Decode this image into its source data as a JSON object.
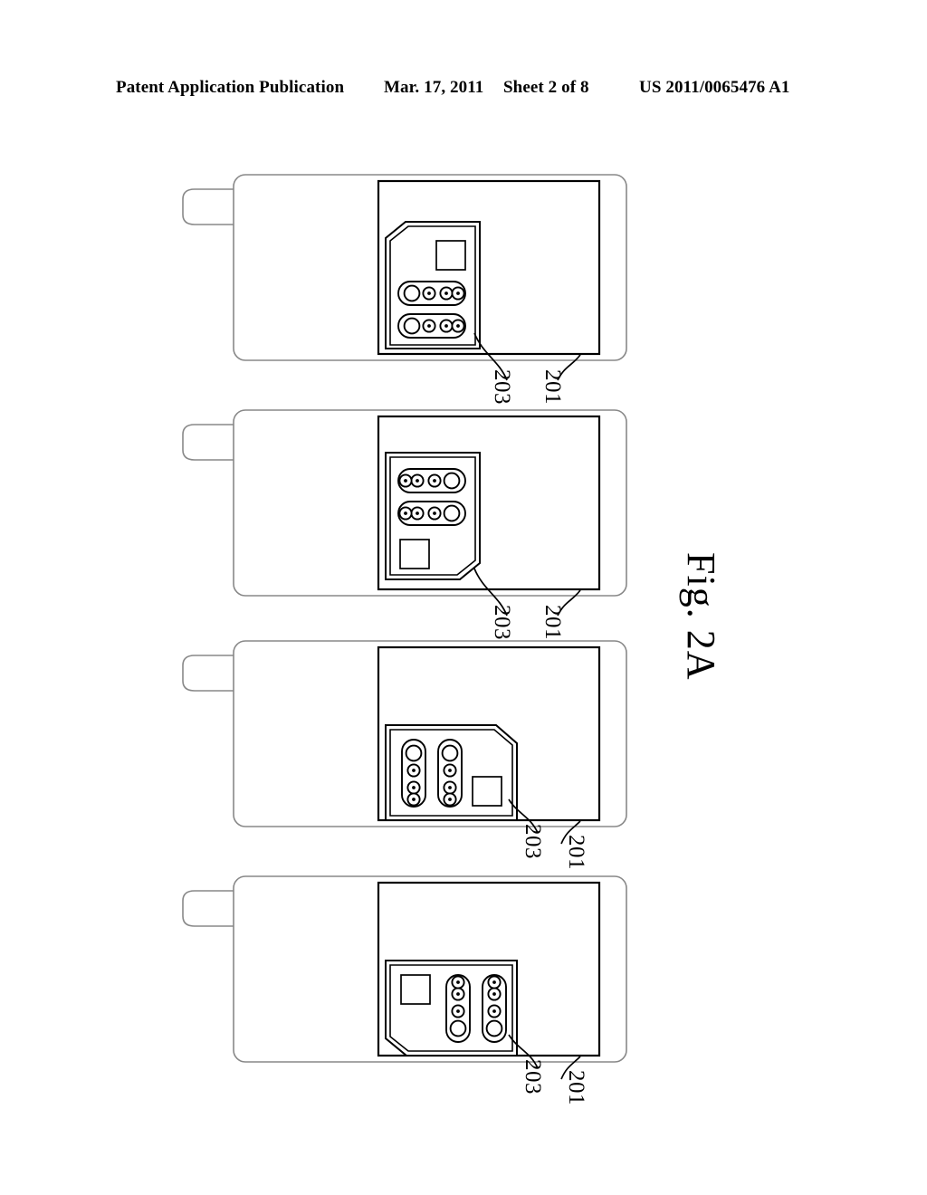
{
  "header": {
    "publication": "Patent Application Publication",
    "date": "Mar. 17, 2011",
    "sheet": "Sheet 2 of 8",
    "patent_number": "US 2011/0065476 A1"
  },
  "figure": {
    "caption": "Fig. 2A",
    "orientation": "rotated-90-clockwise",
    "panel_count": 4,
    "reference_numerals": {
      "device_body": "201",
      "sim_card": "203"
    },
    "colors": {
      "line": "#000000",
      "faint_line": "#888888",
      "background": "#ffffff"
    },
    "panels": [
      {
        "index": 1,
        "label_sim": "203",
        "label_body": "201",
        "sim_orientation_deg": 0,
        "notch_corner": "top-left",
        "contact_layout": "horizontal",
        "large_contact_position": "left",
        "square_pad_position": "top-right"
      },
      {
        "index": 2,
        "label_sim": "203",
        "label_body": "201",
        "sim_orientation_deg": 180,
        "notch_corner": "bottom-right",
        "contact_layout": "horizontal",
        "large_contact_position": "right",
        "square_pad_position": "bottom-left"
      },
      {
        "index": 3,
        "label_sim": "203",
        "label_body": "201",
        "sim_orientation_deg": 90,
        "notch_corner": "top-right",
        "contact_layout": "vertical",
        "large_contact_position": "top",
        "square_pad_position": "bottom-right"
      },
      {
        "index": 4,
        "label_sim": "203",
        "label_body": "201",
        "sim_orientation_deg": 270,
        "notch_corner": "bottom-left",
        "contact_layout": "vertical",
        "large_contact_position": "bottom",
        "square_pad_position": "top-left"
      }
    ]
  }
}
